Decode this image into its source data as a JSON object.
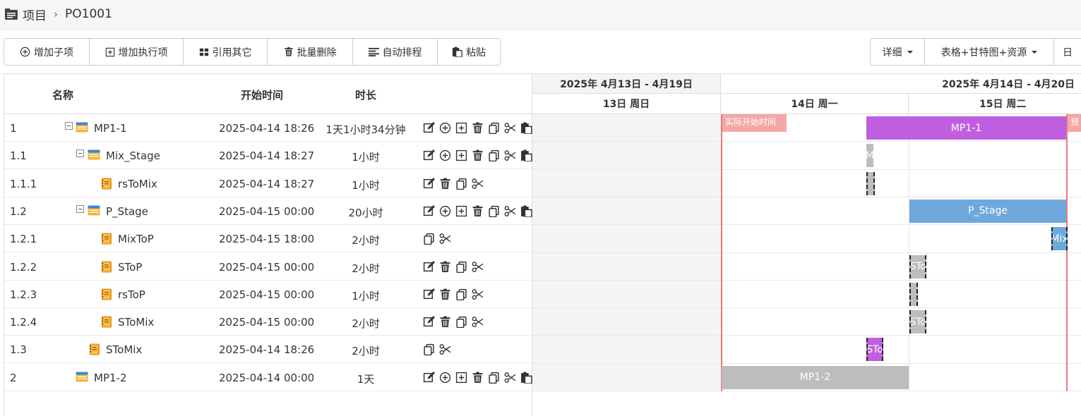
{
  "breadcrumb": {
    "root": "项目",
    "current": "PO1001"
  },
  "toolbar": {
    "left": [
      {
        "label": "增加子项",
        "icon": "plus-circle-icon"
      },
      {
        "label": "增加执行项",
        "icon": "plus-square-icon"
      },
      {
        "label": "引用其它",
        "icon": "grid-icon"
      },
      {
        "label": "批量删除",
        "icon": "trash-icon"
      },
      {
        "label": "自动排程",
        "icon": "align-left-icon"
      },
      {
        "label": "粘贴",
        "icon": "paste-icon"
      }
    ],
    "right": [
      {
        "label": "详细"
      },
      {
        "label": "表格+甘特图+资源"
      },
      {
        "label": "日"
      }
    ]
  },
  "table": {
    "headers": {
      "name": "名称",
      "start": "开始时间",
      "duration": "时长"
    },
    "rows": [
      {
        "wbs": "1",
        "name": "MP1-1",
        "start": "2025-04-14 18:26",
        "duration": "1天1小时34分钟"
      },
      {
        "wbs": "1.1",
        "name": "Mix_Stage",
        "start": "2025-04-14 18:27",
        "duration": "1小时"
      },
      {
        "wbs": "1.1.1",
        "name": "rsToMix",
        "start": "2025-04-14 18:27",
        "duration": "1小时"
      },
      {
        "wbs": "1.2",
        "name": "P_Stage",
        "start": "2025-04-15 00:00",
        "duration": "20小时"
      },
      {
        "wbs": "1.2.1",
        "name": "MixToP",
        "start": "2025-04-15 18:00",
        "duration": "2小时"
      },
      {
        "wbs": "1.2.2",
        "name": "SToP",
        "start": "2025-04-15 00:00",
        "duration": "2小时"
      },
      {
        "wbs": "1.2.3",
        "name": "rsToP",
        "start": "2025-04-15 00:00",
        "duration": "1小时"
      },
      {
        "wbs": "1.2.4",
        "name": "SToMix",
        "start": "2025-04-15 00:00",
        "duration": "2小时"
      },
      {
        "wbs": "1.3",
        "name": "SToMix",
        "start": "2025-04-14 18:26",
        "duration": "2小时"
      },
      {
        "wbs": "2",
        "name": "MP1-2",
        "start": "2025-04-14 00:00",
        "duration": "1天"
      }
    ]
  },
  "gantt": {
    "weeks": [
      "2025年 4月13日 - 4月19日",
      "2025年 4月14日 - 4月20日"
    ],
    "days": [
      "13日 周日",
      "14日 周一",
      "15日 周二"
    ],
    "markers": {
      "actual_start": "实际开始时间",
      "planned": "预"
    },
    "bars": [
      "MP1-1",
      "M",
      "",
      "P_Stage",
      "Mix",
      "STo",
      "",
      "STo",
      "STo",
      "MP1-2"
    ],
    "colors": {
      "purple": "#bf5fe0",
      "gray": "#bdbdbd",
      "blue": "#6fa8dc",
      "red": "#e77a7a"
    }
  }
}
